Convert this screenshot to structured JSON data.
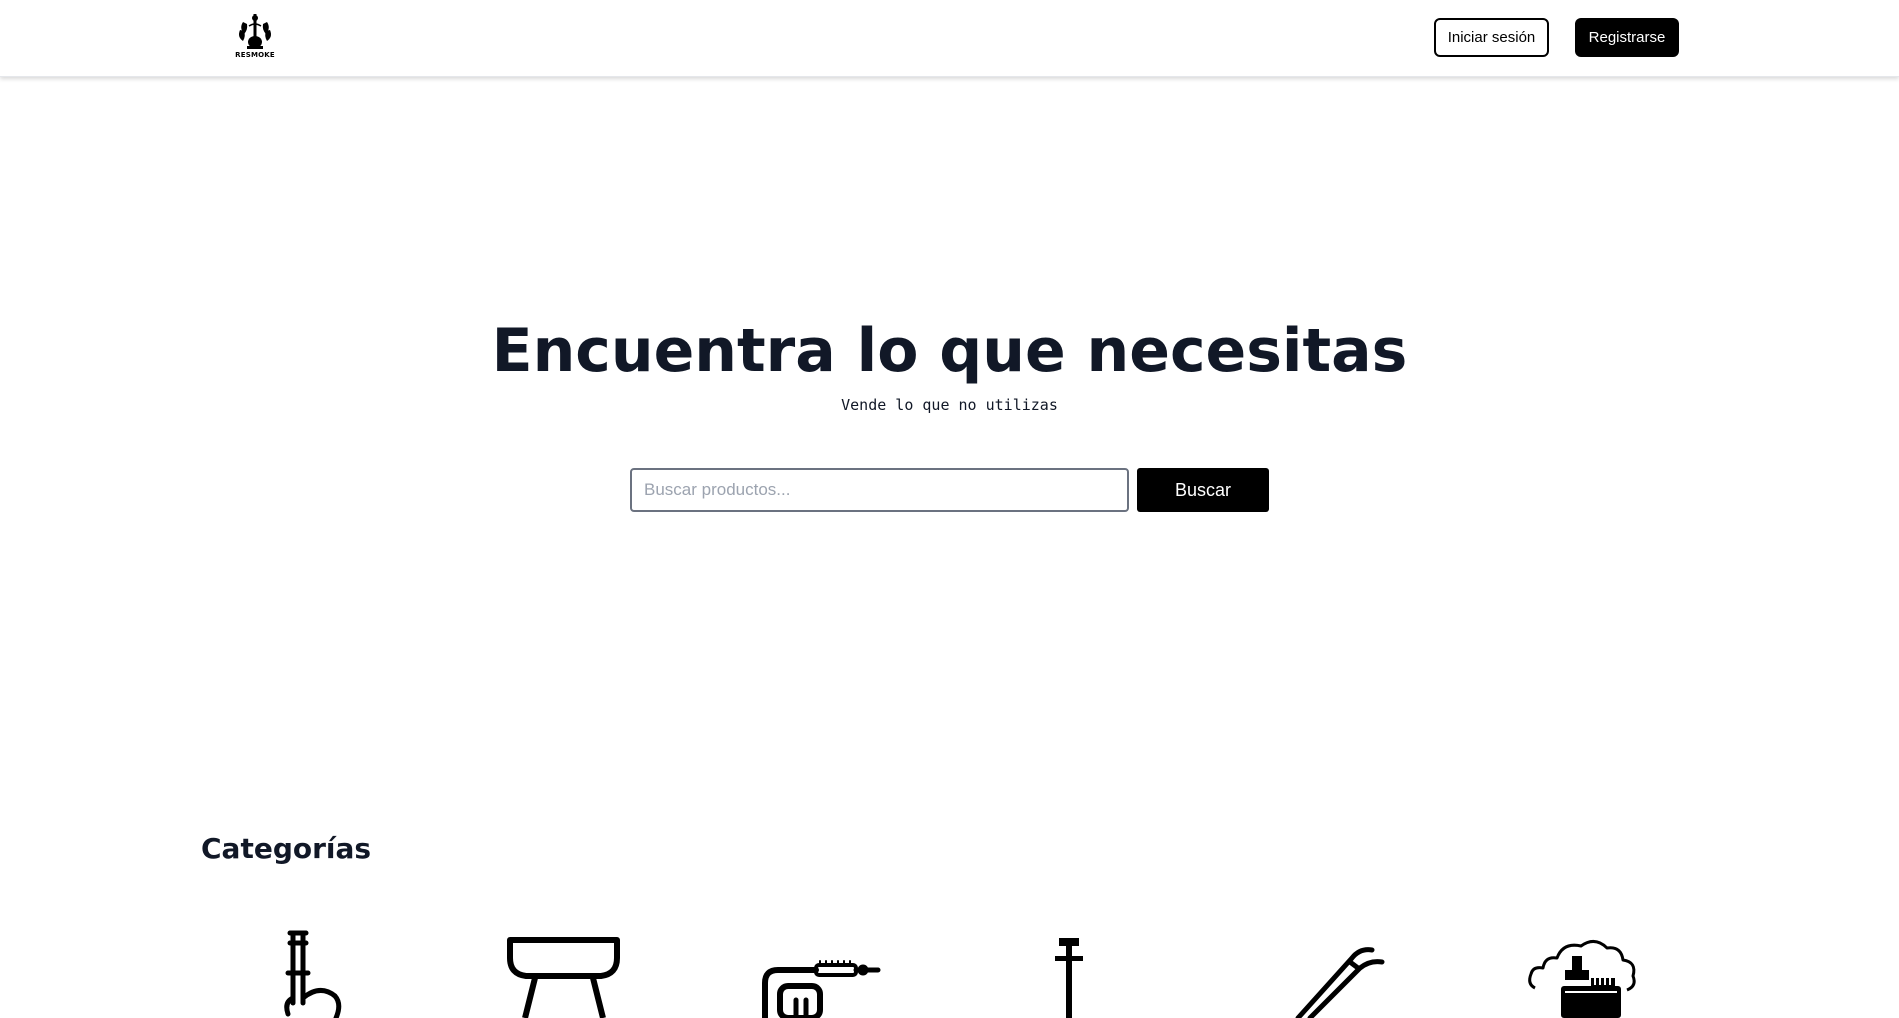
{
  "header": {
    "logo_text": "RESMOKE",
    "login_label": "Iniciar sesión",
    "register_label": "Registrarse"
  },
  "hero": {
    "title": "Encuentra lo que necesitas",
    "subtitle": "Vende lo que no utilizas"
  },
  "search": {
    "placeholder": "Buscar productos...",
    "value": "",
    "button_label": "Buscar"
  },
  "categories": {
    "title": "Categorías",
    "items": [
      {
        "icon": "hookah-icon"
      },
      {
        "icon": "bowl-icon"
      },
      {
        "icon": "hose-icon"
      },
      {
        "icon": "stem-icon"
      },
      {
        "icon": "tongs-icon"
      },
      {
        "icon": "smoke-accessories-icon"
      }
    ]
  },
  "colors": {
    "primary": "#000000",
    "text": "#111827",
    "background": "#ffffff",
    "input_border": "#6b7280"
  }
}
